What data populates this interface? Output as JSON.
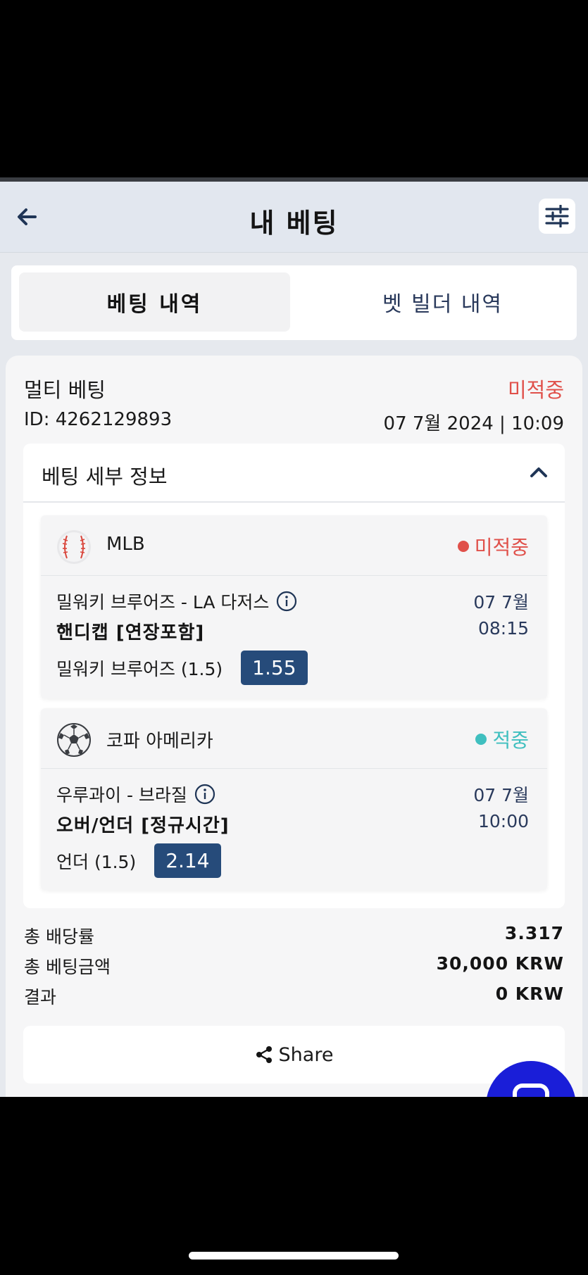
{
  "header": {
    "title": "내 베팅"
  },
  "tabs": [
    {
      "label": "베팅 내역",
      "active": true
    },
    {
      "label": "벳 빌더 내역",
      "active": false
    }
  ],
  "bet": {
    "type": "멀티 베팅",
    "status": "미적중",
    "id": "ID: 4262129893",
    "datetime": "07 7월 2024 | 10:09",
    "details_title": "베팅 세부 정보",
    "selections": [
      {
        "sport_icon": "baseball-icon",
        "league": "MLB",
        "result": "미적중",
        "match": "밀워키 브루어즈 - LA 다저스",
        "date": "07 7월",
        "market": "핸디캡 [연장포함]",
        "time": "08:15",
        "pick": "밀워키 브루어즈 (1.5)",
        "odds": "1.55"
      },
      {
        "sport_icon": "soccer-ball-icon",
        "league": "코파 아메리카",
        "result": "적중",
        "match": "우루과이 - 브라질",
        "date": "07 7월",
        "market": "오버/언더 [정규시간]",
        "time": "10:00",
        "pick": "언더 (1.5)",
        "odds": "2.14"
      }
    ]
  },
  "summary": {
    "total_odds_label": "총 배당률",
    "total_odds": "3.317",
    "stake_label": "총 베팅금액",
    "stake": "30,000 KRW",
    "result_label": "결과",
    "result": "0 KRW"
  },
  "share": {
    "label": "Share"
  },
  "colors": {
    "lost": "#e0504a",
    "won": "#3fbfbf",
    "odds_bg": "#264b7a",
    "fab": "#1a1ed8"
  }
}
